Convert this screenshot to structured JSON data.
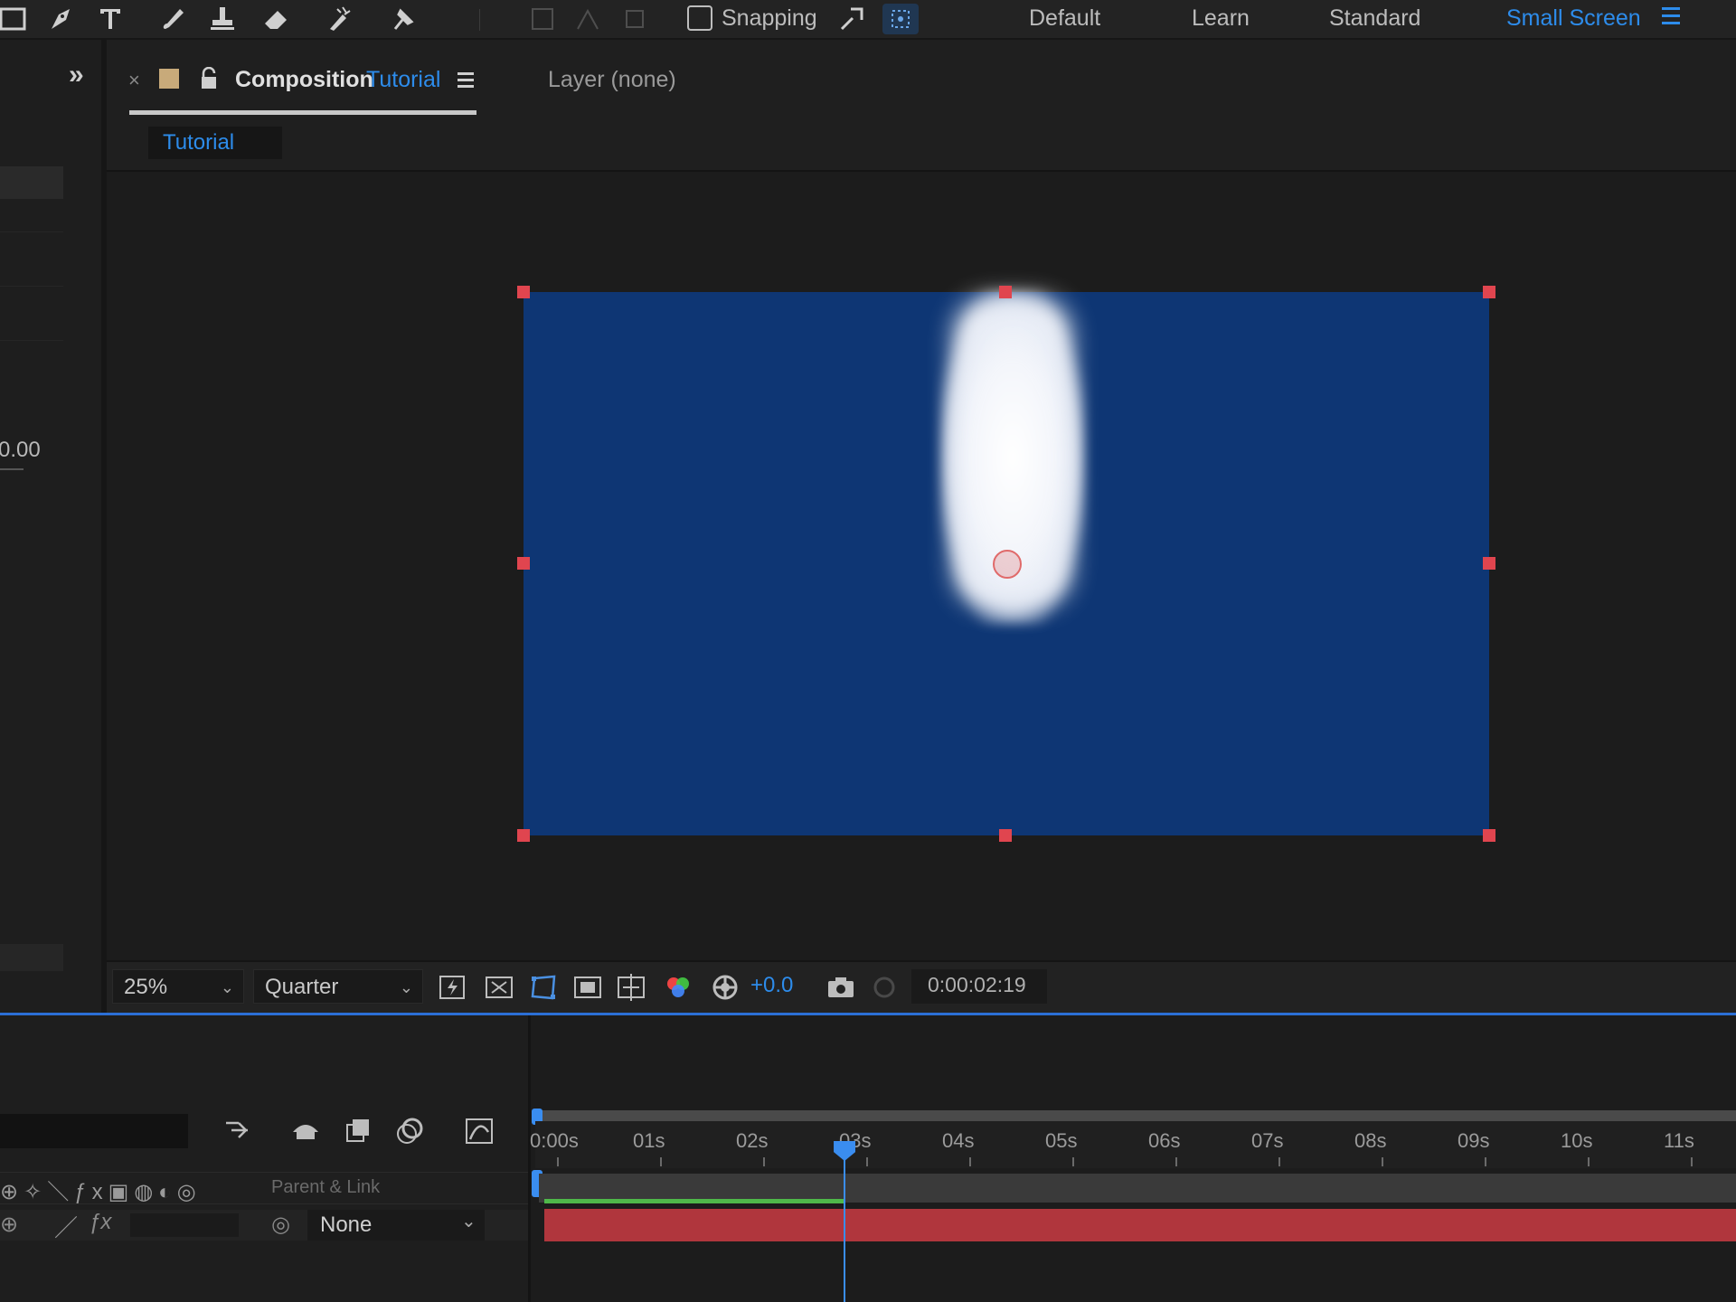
{
  "toolbar": {
    "snapping_label": "Snapping",
    "workspaces": [
      "Default",
      "Learn",
      "Standard",
      "Small Screen"
    ]
  },
  "left_panel": {
    "value": "0.00"
  },
  "composition": {
    "tab_prefix": "Composition",
    "tab_name": "Tutorial",
    "layer_tab": "Layer (none)",
    "sub_tab": "Tutorial"
  },
  "viewer_bar": {
    "zoom": "25%",
    "resolution": "Quarter",
    "exposure": "+0.0",
    "timecode": "0:00:02:19"
  },
  "timeline": {
    "ruler_labels": [
      "0:00s",
      "01s",
      "02s",
      "03s",
      "04s",
      "05s",
      "06s",
      "07s",
      "08s",
      "09s",
      "10s",
      "11s"
    ],
    "parent_link_header": "Parent & Link",
    "parent_value": "None",
    "current_time_seconds": 2.79
  },
  "colors": {
    "accent": "#2d8ceb",
    "comp_background": "#0e3674",
    "layer_bar": "#b0363d",
    "work_area_green": "#4fb84a",
    "handle": "#e0454f"
  },
  "icons": {
    "toolbar": [
      "rectangle-tool-icon",
      "pen-tool-icon",
      "type-tool-icon",
      "brush-tool-icon",
      "clone-stamp-icon",
      "eraser-icon",
      "roto-brush-icon",
      "puppet-pin-icon"
    ],
    "viewer": [
      "fast-previews-icon",
      "transparency-grid-icon",
      "mask-visibility-icon",
      "region-of-interest-icon",
      "grid-guides-icon",
      "color-channels-icon",
      "color-management-icon",
      "snapshot-icon",
      "show-snapshot-icon"
    ]
  }
}
